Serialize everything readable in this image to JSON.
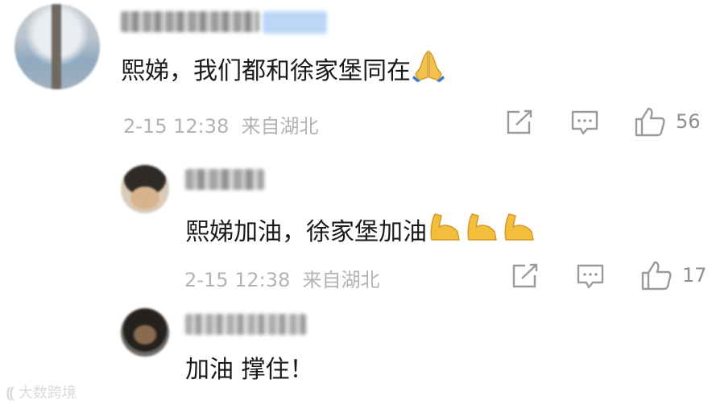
{
  "comments": [
    {
      "text": "熙娣，我们都和徐家堡同在",
      "emoji": "folded-hands",
      "time": "2-15 12:38",
      "location": "来自湖北",
      "likes": "56"
    },
    {
      "text": "熙娣加油，徐家堡加油",
      "emoji": "flexed-biceps x3",
      "time": "2-15 12:38",
      "location": "来自湖北",
      "likes": "17"
    },
    {
      "text": "加油 撑住！"
    }
  ],
  "watermark": "大数跨境",
  "colors": {
    "text": "#1a1a1a",
    "meta": "#b3b3b3",
    "icon": "#9a9a9a"
  }
}
